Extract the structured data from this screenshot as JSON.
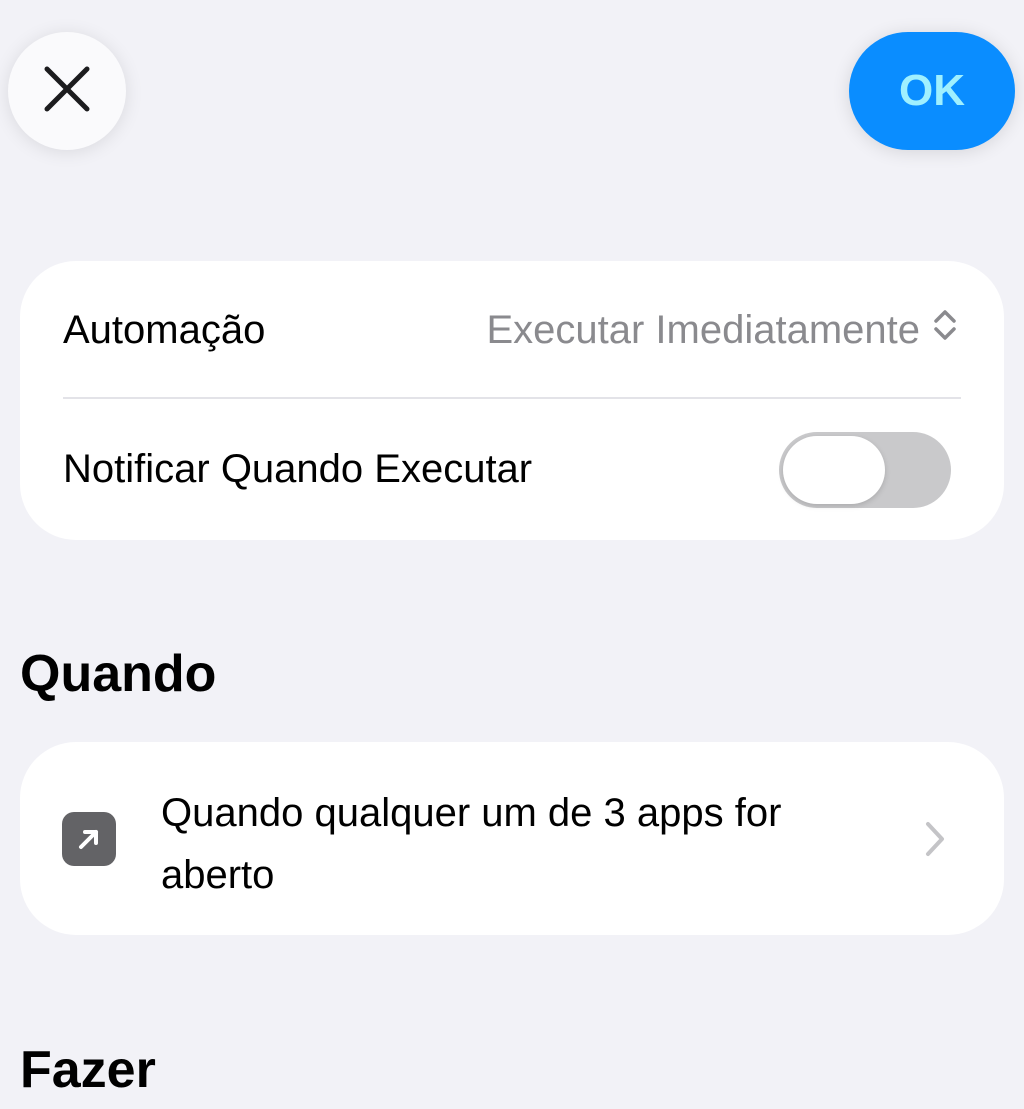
{
  "header": {
    "close_icon": "xmark-icon",
    "ok_label": "OK",
    "ok_color": "#0a8dff"
  },
  "settings": {
    "automation_label": "Automação",
    "automation_value": "Executar Imediatamente",
    "automation_value_icon": "chevron-up-down-icon",
    "notify_label": "Notificar Quando Executar",
    "notify_enabled": false
  },
  "when_section": {
    "title": "Quando",
    "trigger_icon": "arrow-up-right-square-icon",
    "trigger_text": "Quando qualquer um de 3 apps for aberto",
    "chevron_icon": "chevron-right-icon"
  },
  "do_section": {
    "title": "Fazer"
  }
}
